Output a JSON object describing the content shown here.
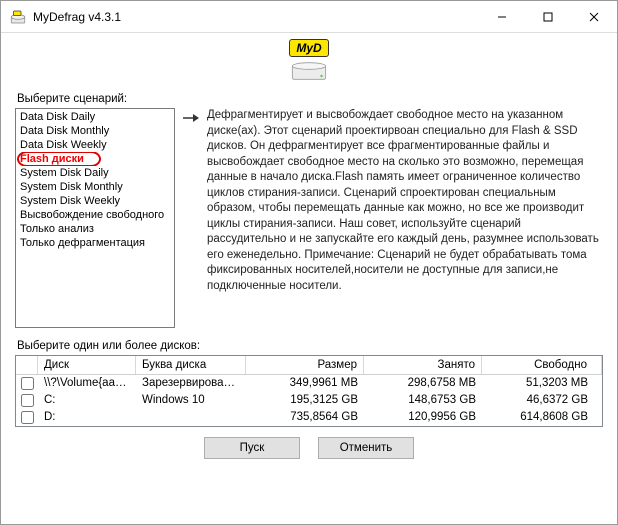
{
  "window": {
    "title": "MyDefrag v4.3.1"
  },
  "logo": {
    "text": "MyD"
  },
  "labels": {
    "choose_scenario": "Выберите сценарий:",
    "choose_disks": "Выберите один или более дисков:"
  },
  "scenarios": [
    "Data Disk Daily",
    "Data Disk Monthly",
    "Data Disk Weekly",
    "Flash диски",
    "System Disk Daily",
    "System Disk Monthly",
    "System Disk Weekly",
    "Высвобождение свободного",
    "Только анализ",
    "Только дефрагментация"
  ],
  "selected_scenario_index": 3,
  "description": "Дефрагментирует и высвобождает свободное место на указанном диске(ах). Этот сценарий проектирвоан специально для Flash & SSD дисков. Он дефрагментирует все фрагментированные файлы и высвобождает свободное место на сколько это возможно, перемещая данные в начало диска.Flash память имеет ограниченное количество циклов стирания-записи. Сценарий спроектирован специальным образом, чтобы перемещать данные как можно, но все же производит циклы стирания-записи. Наш совет, используйте сценарий рассудительно и не запускайте его каждый день, разумнее использовать его еженедельно. Примечание: Сценарий не будет обрабатывать тома фиксированных носителей,носители не доступные для записи,не подключенные носители.",
  "disk_headers": {
    "disk": "Диск",
    "letter": "Буква диска",
    "size": "Размер",
    "used": "Занято",
    "free": "Свободно"
  },
  "disks": [
    {
      "vol": "\\\\?\\Volume{aa…",
      "letter": "Зарезервирова…",
      "size": "349,9961 MB",
      "used": "298,6758 MB",
      "free": "51,3203 MB"
    },
    {
      "vol": "C:",
      "letter": "Windows 10",
      "size": "195,3125 GB",
      "used": "148,6753 GB",
      "free": "46,6372 GB"
    },
    {
      "vol": "D:",
      "letter": "",
      "size": "735,8564 GB",
      "used": "120,9956 GB",
      "free": "614,8608 GB"
    }
  ],
  "buttons": {
    "run": "Пуск",
    "cancel": "Отменить"
  }
}
